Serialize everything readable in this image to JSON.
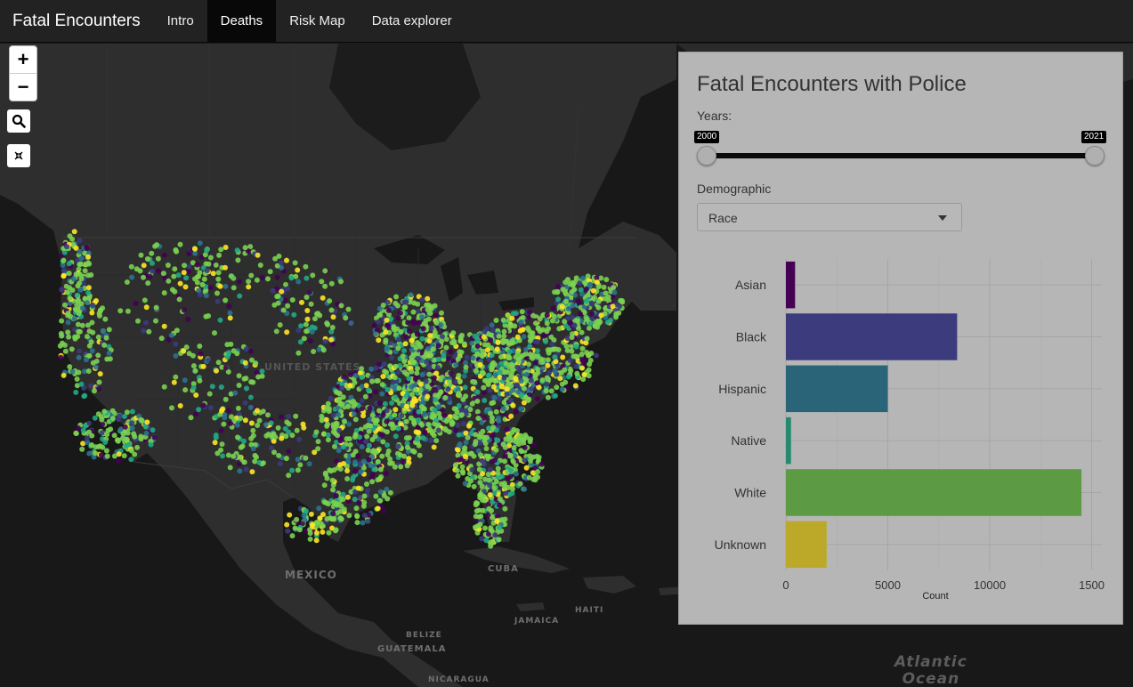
{
  "navbar": {
    "brand": "Fatal Encounters",
    "tabs": [
      {
        "label": "Intro",
        "active": false
      },
      {
        "label": "Deaths",
        "active": true
      },
      {
        "label": "Risk Map",
        "active": false
      },
      {
        "label": "Data explorer",
        "active": false
      }
    ]
  },
  "map": {
    "labels": {
      "united_states": "UNITED STATES",
      "mexico": "MEXICO",
      "cuba": "CUBA",
      "jamaica": "JAMAICA",
      "haiti": "HAITI",
      "belize": "BELIZE",
      "guatemala": "GUATEMALA",
      "nicaragua": "NICARAGUA",
      "atlantic_line1": "Atlantic",
      "atlantic_line2": "Ocean"
    },
    "controls": {
      "zoom_in": "+",
      "zoom_out": "−",
      "search_icon": "search-icon",
      "reset_icon": "collapse-icon"
    },
    "point_colors": [
      "#7ad151",
      "#7ad151",
      "#7ad151",
      "#7ad151",
      "#7ad151",
      "#3b3b7d",
      "#2c728e",
      "#fde725",
      "#22a884",
      "#440154"
    ]
  },
  "panel": {
    "title": "Fatal Encounters with Police",
    "years_label": "Years:",
    "year_min": "2000",
    "year_max": "2021",
    "demographic_label": "Demographic",
    "demographic_value": "Race"
  },
  "chart_data": {
    "type": "bar",
    "orientation": "horizontal",
    "categories": [
      "Asian",
      "Black",
      "Hispanic",
      "Native",
      "White",
      "Unknown"
    ],
    "values": [
      450,
      8400,
      5000,
      250,
      14500,
      2000
    ],
    "colors": [
      "#440154",
      "#3b3b7d",
      "#2a6478",
      "#24896e",
      "#5c9a44",
      "#bca92a"
    ],
    "xlabel": "Count",
    "ylabel": "",
    "xlim": [
      0,
      15500
    ],
    "x_ticks": [
      0,
      5000,
      10000,
      15000
    ],
    "x_tick_labels": [
      "0",
      "5000",
      "10000",
      "1500"
    ],
    "grid": true
  }
}
